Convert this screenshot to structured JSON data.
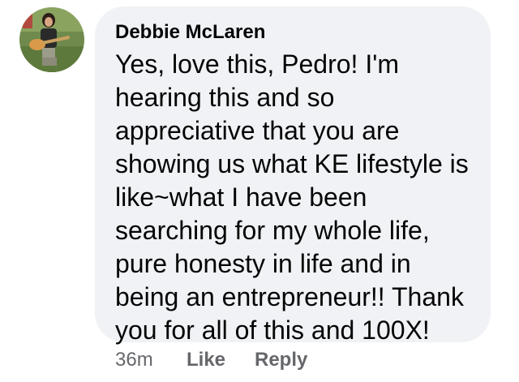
{
  "comment": {
    "author": "Debbie McLaren",
    "avatar_icon": "profile-photo-guitar",
    "lines": [
      "Yes, love this, Pedro! I'm",
      "hearing this and so",
      "appreciative that you are",
      "showing us what KE lifestyle is",
      "like~what I have been",
      "searching for my whole life,",
      "pure honesty in life and in",
      "being an entrepreneur!! Thank",
      "you for all of this and 100X!"
    ],
    "timestamp": "36m",
    "like_label": "Like",
    "reply_label": "Reply"
  },
  "colors": {
    "bubble_background": "#f0f2f5",
    "text": "#050505",
    "secondary_text": "#65676b"
  }
}
